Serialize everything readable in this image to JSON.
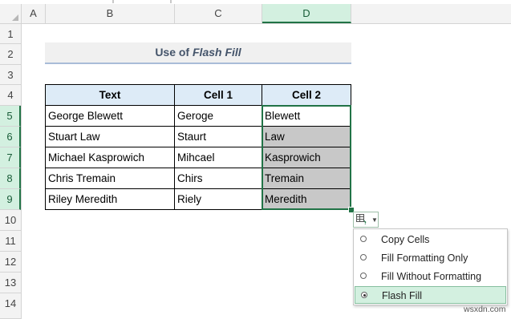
{
  "columns": [
    "A",
    "B",
    "C",
    "D"
  ],
  "active_column": "D",
  "rows": [
    "1",
    "2",
    "3",
    "4",
    "5",
    "6",
    "7",
    "8",
    "9",
    "10",
    "11",
    "12",
    "13",
    "14"
  ],
  "active_rows": [
    "5",
    "6",
    "7",
    "8",
    "9"
  ],
  "title": {
    "prefix": "Use of",
    "emphasis": "Flash Fill"
  },
  "table": {
    "headers": [
      "Text",
      "Cell 1",
      "Cell 2"
    ],
    "rows": [
      [
        "George Blewett",
        "Geroge",
        "Blewett"
      ],
      [
        "Stuart Law",
        "Staurt",
        "Law"
      ],
      [
        "Michael Kasprowich",
        "Mihcael",
        "Kasprowich"
      ],
      [
        "Chris Tremain",
        "Chirs",
        "Tremain"
      ],
      [
        "Riley Meredith",
        "Riely",
        "Meredith"
      ]
    ]
  },
  "flash_fill_menu": {
    "items": [
      {
        "label": "Copy Cells",
        "selected": false
      },
      {
        "label": "Fill Formatting Only",
        "selected": false
      },
      {
        "label": "Fill Without Formatting",
        "selected": false
      },
      {
        "label": "Flash Fill",
        "selected": true
      }
    ]
  },
  "watermark": "wsxdn.com",
  "colors": {
    "accent": "#217346",
    "header_fill": "#ddebf7",
    "flash_fill_gray": "#c8c8c8"
  }
}
